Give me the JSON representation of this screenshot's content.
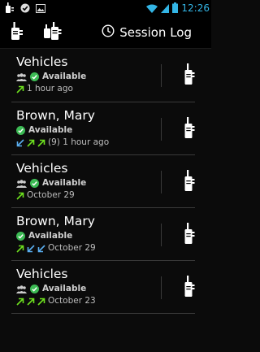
{
  "status_bar": {
    "time": "12:26"
  },
  "action_bar": {
    "session_label": "Session Log"
  },
  "items": [
    {
      "name": "Vehicles",
      "status": "Available",
      "time": "1 hour ago"
    },
    {
      "name": "Brown, Mary",
      "status": "Available",
      "time": "(9) 1 hour ago"
    },
    {
      "name": "Vehicles",
      "status": "Available",
      "time": "October 29"
    },
    {
      "name": "Brown, Mary",
      "status": "Available",
      "time": "October 29"
    },
    {
      "name": "Vehicles",
      "status": "Available",
      "time": "October 23"
    }
  ],
  "colors": {
    "accent": "#33b5e5",
    "available": "#3cba54",
    "outgoing": "#6ee01f",
    "incoming": "#5aaef0"
  },
  "icons": {
    "status_bar": [
      "radio-icon",
      "check-circle-icon",
      "image-icon",
      "wifi-icon",
      "signal-icon",
      "battery-icon"
    ],
    "action_bar": [
      "radio-icon",
      "radio-group-icon",
      "clock-icon"
    ],
    "item": [
      "group-icon",
      "check-circle-icon",
      "arrow-up-right-icon",
      "arrow-down-left-icon",
      "radio-icon"
    ]
  }
}
